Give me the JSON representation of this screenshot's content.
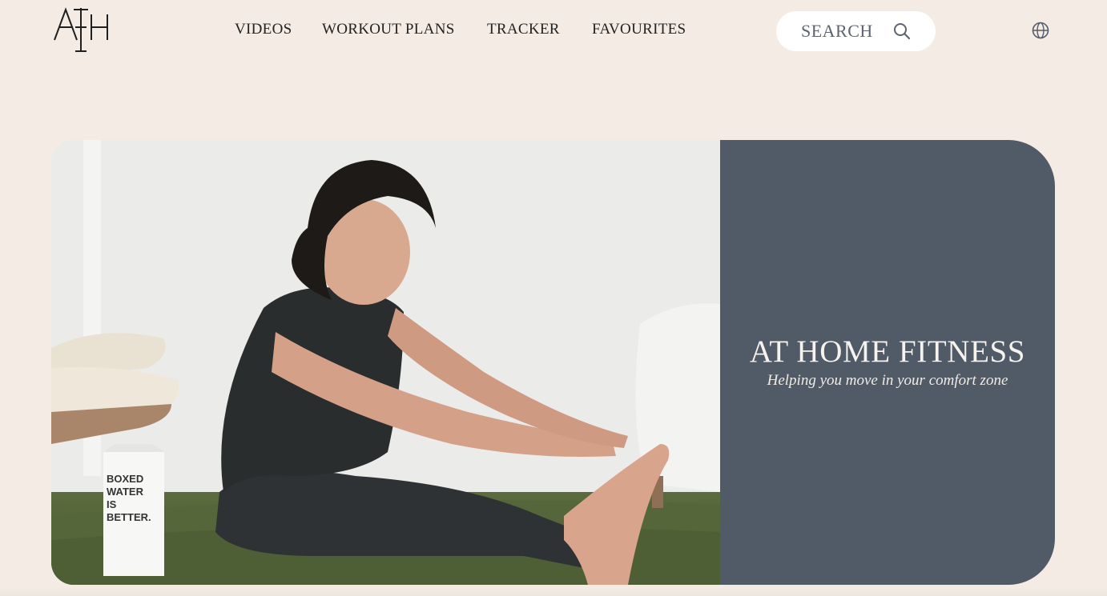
{
  "brand": {
    "logo_text": "AFH"
  },
  "nav": {
    "items": [
      {
        "label": "VIDEOS"
      },
      {
        "label": "WORKOUT PLANS"
      },
      {
        "label": "TRACKER"
      },
      {
        "label": "FAVOURITES"
      }
    ]
  },
  "search": {
    "label": "SEARCH",
    "icon": "search-icon"
  },
  "language": {
    "icon": "globe-icon"
  },
  "hero": {
    "title": "AT HOME FITNESS",
    "subtitle": "Helping you move in your comfort zone",
    "photo_carton_text": "BOXED WATER IS BETTER."
  },
  "colors": {
    "page_background": "#f3ebe4",
    "hero_panel": "#515a67",
    "hero_text": "#f6f2ee",
    "nav_text": "#222222",
    "search_background": "#ffffff"
  }
}
